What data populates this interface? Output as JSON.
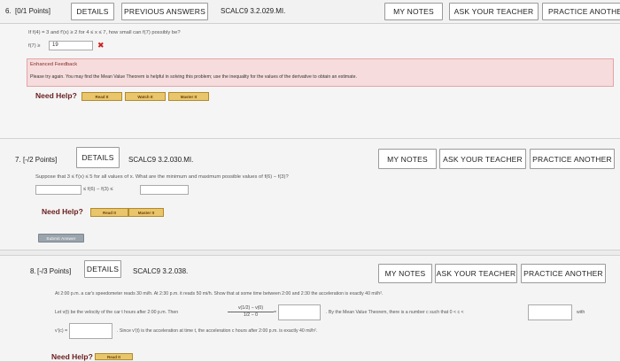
{
  "q6": {
    "number": "6.",
    "points": "[0/1 Points]",
    "details": "DETAILS",
    "previous": "PREVIOUS ANSWERS",
    "code": "SCALC9 3.2.029.MI.",
    "my_notes": "MY NOTES",
    "ask": "ASK YOUR TEACHER",
    "practice": "PRACTICE ANOTHER",
    "prompt": "If f(4) = 3 and f'(x) ≥ 2 for 4 ≤ x ≤ 7, how small can f(7) possibly be?",
    "answer_prefix": "f(7) ≥",
    "answer_value": "19",
    "wrong_mark": "✖",
    "feedback_title": "Enhanced Feedback",
    "feedback_text": "Please try again. You may find the Mean Value Theorem is helpful in solving this problem; use the inequality for the values of the derivative to obtain an estimate.",
    "need_help": "Need Help?",
    "read": "Read It",
    "watch": "Watch It",
    "master": "Master It"
  },
  "q7": {
    "number": "7.",
    "points": "[-/2 Points]",
    "details": "DETAILS",
    "code": "SCALC9 3.2.030.MI.",
    "my_notes": "MY NOTES",
    "ask": "ASK YOUR TEACHER",
    "practice": "PRACTICE ANOTHER",
    "prompt": "Suppose that 3 ≤ f'(x) ≤ 5 for all values of x. What are the minimum and maximum possible values of f(6) − f(3)?",
    "ineq_mid": "≤ f(6) − f(3) ≤",
    "need_help": "Need Help?",
    "read": "Read It",
    "master": "Master It",
    "submit": "Submit Answer"
  },
  "q8": {
    "number": "8.",
    "points": "[-/3 Points]",
    "details": "DETAILS",
    "code": "SCALC9 3.2.038.",
    "my_notes": "MY NOTES",
    "ask": "ASK YOUR TEACHER",
    "practice": "PRACTICE ANOTHER",
    "prompt": "At 2:00 p.m. a car's speedometer reads 30 mi/h. At 2:30 p.m. it reads 50 mi/h. Show that at some time between 2:00 and 2:30 the acceleration is exactly 40 mi/h².",
    "line2_a": "Let v(t) be the velocity of the car t hours after 2:00 p.m. Then",
    "frac_num": "v(1/2) − v(0)",
    "frac_den": "1/2 − 0",
    "line2_b": ". By the Mean Value Theorem, there is a number c such that 0 < c <",
    "line2_c": "with",
    "line3_a": "v'(c) =",
    "line3_b": ". Since v'(t) is the acceleration at time t, the acceleration c hours after 2:00 p.m. is exactly 40 mi/h².",
    "need_help": "Need Help?",
    "read": "Read It"
  }
}
